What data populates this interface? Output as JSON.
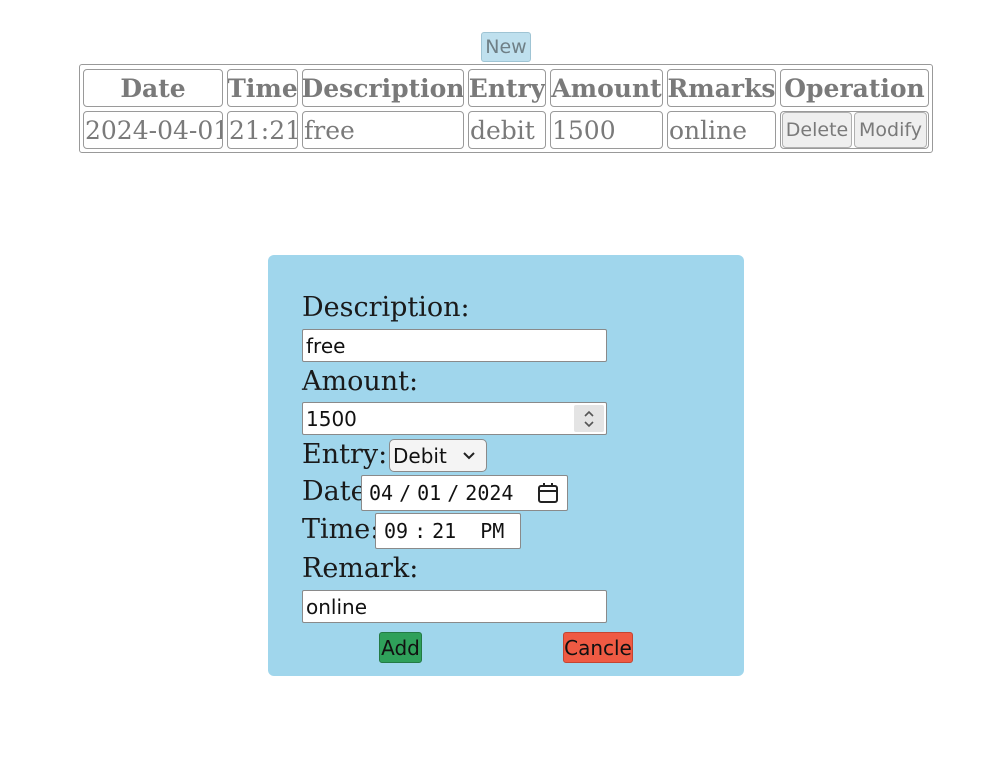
{
  "toolbar": {
    "new_label": "New"
  },
  "table": {
    "headers": [
      "Date",
      "Time",
      "Description",
      "Entry",
      "Amount",
      "Rmarks",
      "Operation"
    ],
    "rows": [
      {
        "date": "2024-04-01",
        "time": "21:21",
        "description": "free",
        "entry": "debit",
        "amount": "1500",
        "remarks": "online",
        "delete_label": "Delete",
        "modify_label": "Modify"
      }
    ]
  },
  "form": {
    "description_label": "Description:",
    "description_value": "free",
    "amount_label": "Amount:",
    "amount_value": "1500",
    "entry_label": "Entry:",
    "entry_value": "Debit",
    "date_label": "Date",
    "date_month": "04",
    "date_day": "01",
    "date_year": "2024",
    "time_label": "Time:",
    "time_hour": "09",
    "time_minute": "21",
    "time_period": "PM",
    "remark_label": "Remark:",
    "remark_value": "online",
    "add_label": "Add",
    "cancel_label": "Cancle"
  },
  "colors": {
    "form_bg": "#a0d6ec",
    "add_button": "#2fa05a",
    "cancel_button": "#ef5a43",
    "new_button": "#bfe0ee"
  },
  "icons": [
    "calendar-icon",
    "chevron-down-icon",
    "spin-up-icon",
    "spin-down-icon"
  ]
}
